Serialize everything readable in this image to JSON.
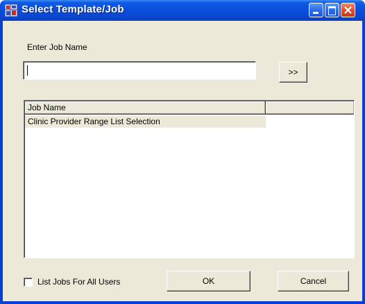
{
  "window": {
    "title": "Select Template/Job",
    "title_icon": "app-window-icon",
    "controls": [
      "minimize-icon",
      "maximize-icon",
      "close-icon"
    ]
  },
  "form": {
    "job_name_label": "Enter Job Name",
    "job_name_value": "",
    "go_button_label": ">>"
  },
  "list": {
    "columns": [
      "Job Name",
      ""
    ],
    "rows": [
      [
        "Clinic Provider Range List Selection",
        ""
      ]
    ]
  },
  "footer": {
    "all_users_label": "List Jobs For All Users",
    "all_users_checked": false,
    "ok_label": "OK",
    "cancel_label": "Cancel"
  },
  "colors": {
    "title_bar": "#0a4fdc",
    "dialog_face": "#ece9d8",
    "close_button": "#e0502b"
  }
}
